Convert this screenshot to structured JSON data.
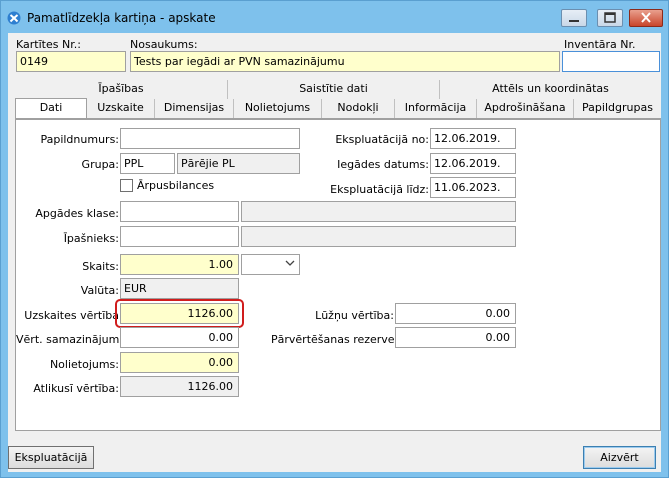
{
  "window": {
    "title": "Pamatlīdzekļa kartiņa - apskate"
  },
  "header": {
    "card_no_label": "Kartītes Nr.:",
    "card_no_value": "0149",
    "name_label": "Nosaukums:",
    "name_value": "Tests par iegādi ar PVN samazinājumu",
    "inventory_label": "Inventāra Nr.",
    "inventory_value": ""
  },
  "tabs_row1": [
    "Īpašības",
    "Saistītie dati",
    "Attēls un koordinātas"
  ],
  "tabs_row2": [
    "Dati",
    "Uzskaite",
    "Dimensijas",
    "Nolietojums",
    "Nodokļi",
    "Informācija",
    "Apdrošināšana",
    "Papildgrupas"
  ],
  "fields": {
    "papildnumurs_label": "Papildnumurs:",
    "papildnumurs_value": "",
    "grupa_label": "Grupa:",
    "grupa_code": "PPL",
    "grupa_name": "Pārējie PL",
    "arpusbilances_label": "Ārpusbilances",
    "apgades_klase_label": "Apgādes klase:",
    "ipasnieks_label": "Īpašnieks:",
    "skaits_label": "Skaits:",
    "skaits_value": "1.00",
    "valuta_label": "Valūta:",
    "valuta_value": "EUR",
    "uzskaites_vertiba_label": "Uzskaites vērtība",
    "uzskaites_vertiba_value": "1126.00",
    "vert_samazinajums_label": "Vērt. samazinājums:",
    "vert_samazinajums_value": "0.00",
    "nolietojums_label": "Nolietojums:",
    "nolietojums_value": "0.00",
    "atlikusi_vertiba_label": "Atlikusī vērtība:",
    "atlikusi_vertiba_value": "1126.00",
    "ekspl_no_label": "Ekspluatācijā no:",
    "ekspl_no_value": "12.06.2019.",
    "iegades_datums_label": "Iegādes datums:",
    "iegades_datums_value": "12.06.2019.",
    "ekspl_lidz_label": "Ekspluatācijā līdz:",
    "ekspl_lidz_value": "11.06.2023.",
    "luznu_vertiba_label": "Lūžņu vērtība:",
    "luznu_vertiba_value": "0.00",
    "parvertesanas_label": "Pārvērtēšanas rezerve:",
    "parvertesanas_value": "0.00"
  },
  "buttons": {
    "ekspluatacija": "Ekspluatācijā",
    "aizvert": "Aizvērt"
  }
}
